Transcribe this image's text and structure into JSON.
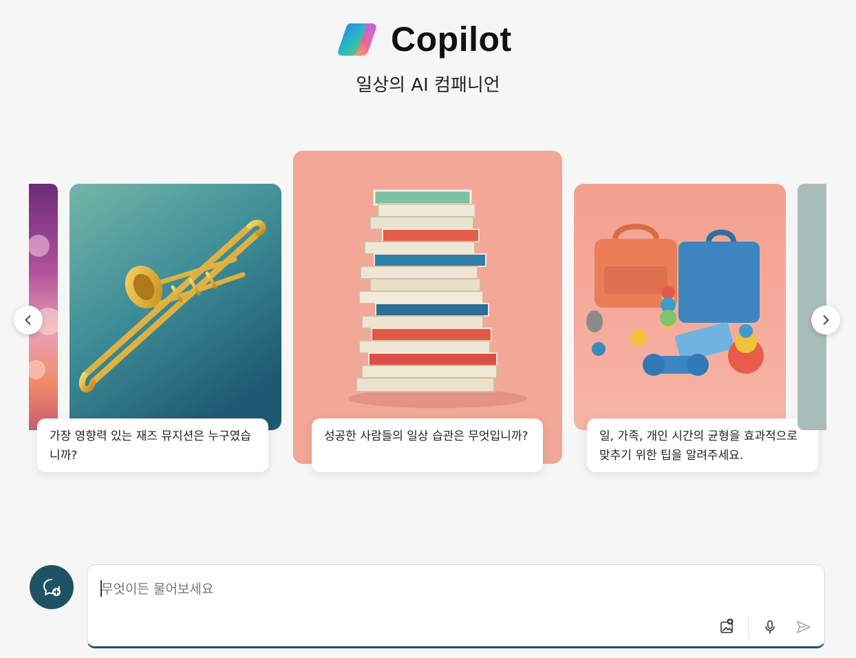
{
  "app": {
    "title": "Copilot",
    "tagline": "일상의 AI 컴패니언"
  },
  "carousel": {
    "prev_icon": "chevron-left-icon",
    "next_icon": "chevron-right-icon",
    "cards": [
      {
        "image": "cosmic-nebula-image",
        "caption": ""
      },
      {
        "image": "trombone-image",
        "caption": "가장 영향력 있는 재즈 뮤지션은 누구였습니까?"
      },
      {
        "image": "stacked-books-image",
        "caption": "성공한 사람들의 일상 습관은 무엇입니까?"
      },
      {
        "image": "bags-and-toys-image",
        "caption": "일, 가족, 개인 시간의 균형을 효과적으로 맞추기 위한 팁을 알려주세요."
      },
      {
        "image": "partial-next-image",
        "caption": ""
      }
    ]
  },
  "composer": {
    "placeholder": "무엇이든 물어보세요",
    "value": "",
    "new_chat_icon": "new-chat-icon",
    "tools": [
      "add-image-icon",
      "microphone-icon",
      "send-icon"
    ]
  },
  "colors": {
    "accent": "#205266",
    "background": "#f6f6f6",
    "books_card": "#f0a596",
    "toys_card": "#f3a495"
  }
}
